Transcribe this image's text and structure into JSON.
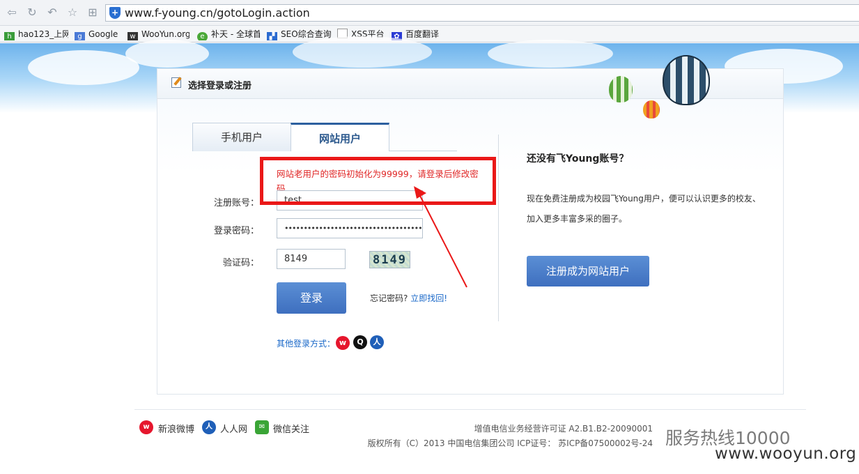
{
  "browser": {
    "url": "www.f-young.cn/gotoLogin.action",
    "bookmarks": [
      {
        "label": "hao123_上网",
        "icon": "hao123-icon"
      },
      {
        "label": "Google",
        "icon": "google-icon"
      },
      {
        "label": "WooYun.org",
        "icon": "wooyun-icon"
      },
      {
        "label": "补天 - 全球首",
        "icon": "butian-icon"
      },
      {
        "label": "SEO综合查询",
        "icon": "seo-icon"
      },
      {
        "label": "XSS平台",
        "icon": "page-icon"
      },
      {
        "label": "百度翻译",
        "icon": "baidu-icon"
      }
    ]
  },
  "panel": {
    "header_title": "选择登录或注册",
    "tabs": [
      "手机用户",
      "网站用户"
    ],
    "active_tab": "网站用户",
    "notice": "网站老用户的密码初始化为99999，请登录后修改密码"
  },
  "form": {
    "account_label": "注册账号：",
    "account_value": "test",
    "password_label": "登录密码：",
    "password_value": "••••••••••••••••••••••••••••••••••••••",
    "captcha_label": "验证码：",
    "captcha_value": "8149",
    "captcha_image_text": "8149",
    "login_button": "登录",
    "forgot_text": "忘记密码?",
    "forgot_link": "立即找回!",
    "other_login": "其他登录方式："
  },
  "register": {
    "title": "还没有飞Young账号？",
    "desc_line1": "现在免费注册成为校园飞Young用户，便可以认识更多的校友、",
    "desc_line2": "加入更多丰富多采的圈子。",
    "button": "注册成为网站用户"
  },
  "footer": {
    "links": [
      "新浪微博",
      "人人网",
      "微信关注"
    ],
    "license": "增值电信业务经营许可证 A2.B1.B2-20090001",
    "copyright": "版权所有（C）2013 中国电信集团公司 ICP证号： 苏ICP备07500002号-24",
    "hotline": "服务热线10000"
  },
  "watermark": "www.wooyun.org",
  "colors": {
    "accent": "#3e6fbf",
    "warning": "#ea1818"
  }
}
